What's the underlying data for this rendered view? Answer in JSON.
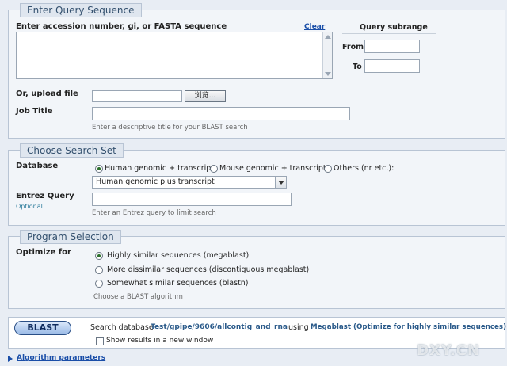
{
  "query_section": {
    "legend": "Enter Query Sequence",
    "accession_label": "Enter accession number, gi, or FASTA sequence",
    "clear_label": "Clear",
    "subrange_title": "Query subrange",
    "from_label": "From",
    "to_label": "To",
    "upload_label": "Or, upload file",
    "browse_label": "浏览...",
    "job_title_label": "Job Title",
    "job_title_hint": "Enter a descriptive title for your BLAST search"
  },
  "search_set": {
    "legend": "Choose Search Set",
    "database_label": "Database",
    "radios": [
      {
        "label": "Human genomic + transcript",
        "checked": true
      },
      {
        "label": "Mouse genomic + transcript",
        "checked": false
      },
      {
        "label": "Others (nr etc.):",
        "checked": false
      }
    ],
    "database_select_value": "Human genomic plus transcript",
    "entrez_label": "Entrez Query",
    "entrez_optional": "Optional",
    "entrez_hint": "Enter an Entrez query to limit search"
  },
  "program": {
    "legend": "Program Selection",
    "optimize_label": "Optimize for",
    "options": [
      {
        "label": "Highly similar sequences (megablast)",
        "checked": true
      },
      {
        "label": "More dissimilar sequences (discontiguous megablast)",
        "checked": false
      },
      {
        "label": "Somewhat similar sequences (blastn)",
        "checked": false
      }
    ],
    "hint": "Choose a BLAST algorithm"
  },
  "blast_bar": {
    "button_label": "BLAST",
    "search_db_prefix": "Search database",
    "database_name": "Test/gpipe/9606/allcontig_and_rna",
    "using_text": "using",
    "algorithm_text": "Megablast (Optimize for highly similar sequences)",
    "new_window_label": "Show results in a new window"
  },
  "footer": {
    "algorithm_params_label": "Algorithm parameters",
    "watermark": "DXY.CN"
  }
}
